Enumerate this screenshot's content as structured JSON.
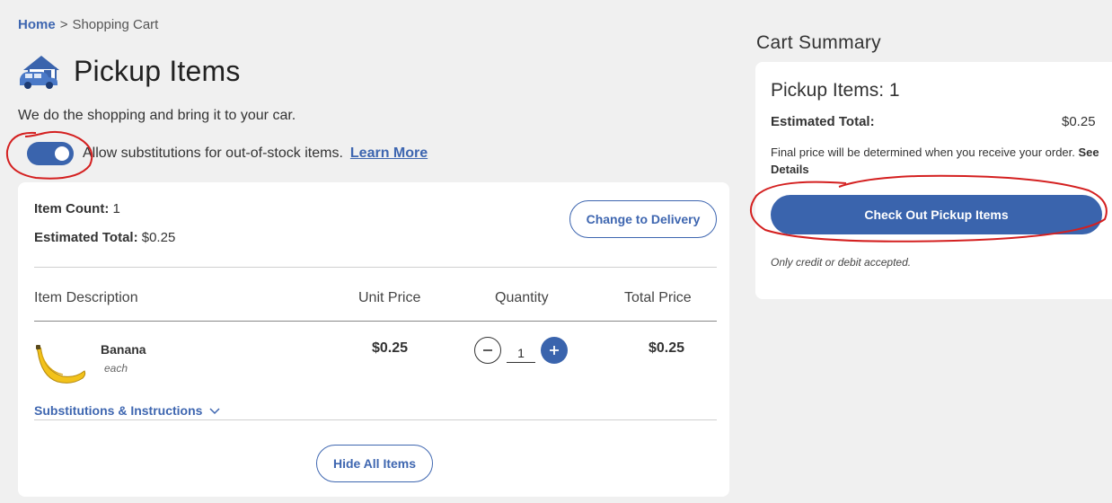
{
  "breadcrumb": {
    "home": "Home",
    "separator": ">",
    "current": "Shopping Cart"
  },
  "page": {
    "title": "Pickup Items",
    "title_icon": "pickup-car-store-icon",
    "tagline": "We do the shopping and bring it to your car."
  },
  "substitutions": {
    "toggle_on": true,
    "label": "Allow substitutions for out-of-stock items.",
    "learn_more": "Learn More"
  },
  "cart": {
    "item_count_label": "Item Count:",
    "item_count": "1",
    "estimated_total_label": "Estimated Total:",
    "estimated_total": "$0.25",
    "change_button": "Change to Delivery",
    "columns": [
      "Item Description",
      "Unit Price",
      "Quantity",
      "Total Price"
    ],
    "items": [
      {
        "name": "Banana",
        "unit": "each",
        "unit_price": "$0.25",
        "quantity": "1",
        "total_price": "$0.25",
        "icon": "banana-icon"
      }
    ],
    "subs_instructions_link": "Substitutions & Instructions",
    "hide_button": "Hide All Items"
  },
  "summary": {
    "heading": "Cart Summary",
    "pickup_items": "Pickup Items: 1",
    "estimated_total_label": "Estimated Total:",
    "estimated_total": "$0.25",
    "note": "Final price will be determined when you receive your order.",
    "see_details": "See Details",
    "checkout_button": "Check Out Pickup Items",
    "payment_note": "Only credit or debit accepted."
  },
  "colors": {
    "accent": "#3a64ad",
    "link": "#3e66b0",
    "annotation": "#d42020",
    "background": "#f0f0f0"
  }
}
